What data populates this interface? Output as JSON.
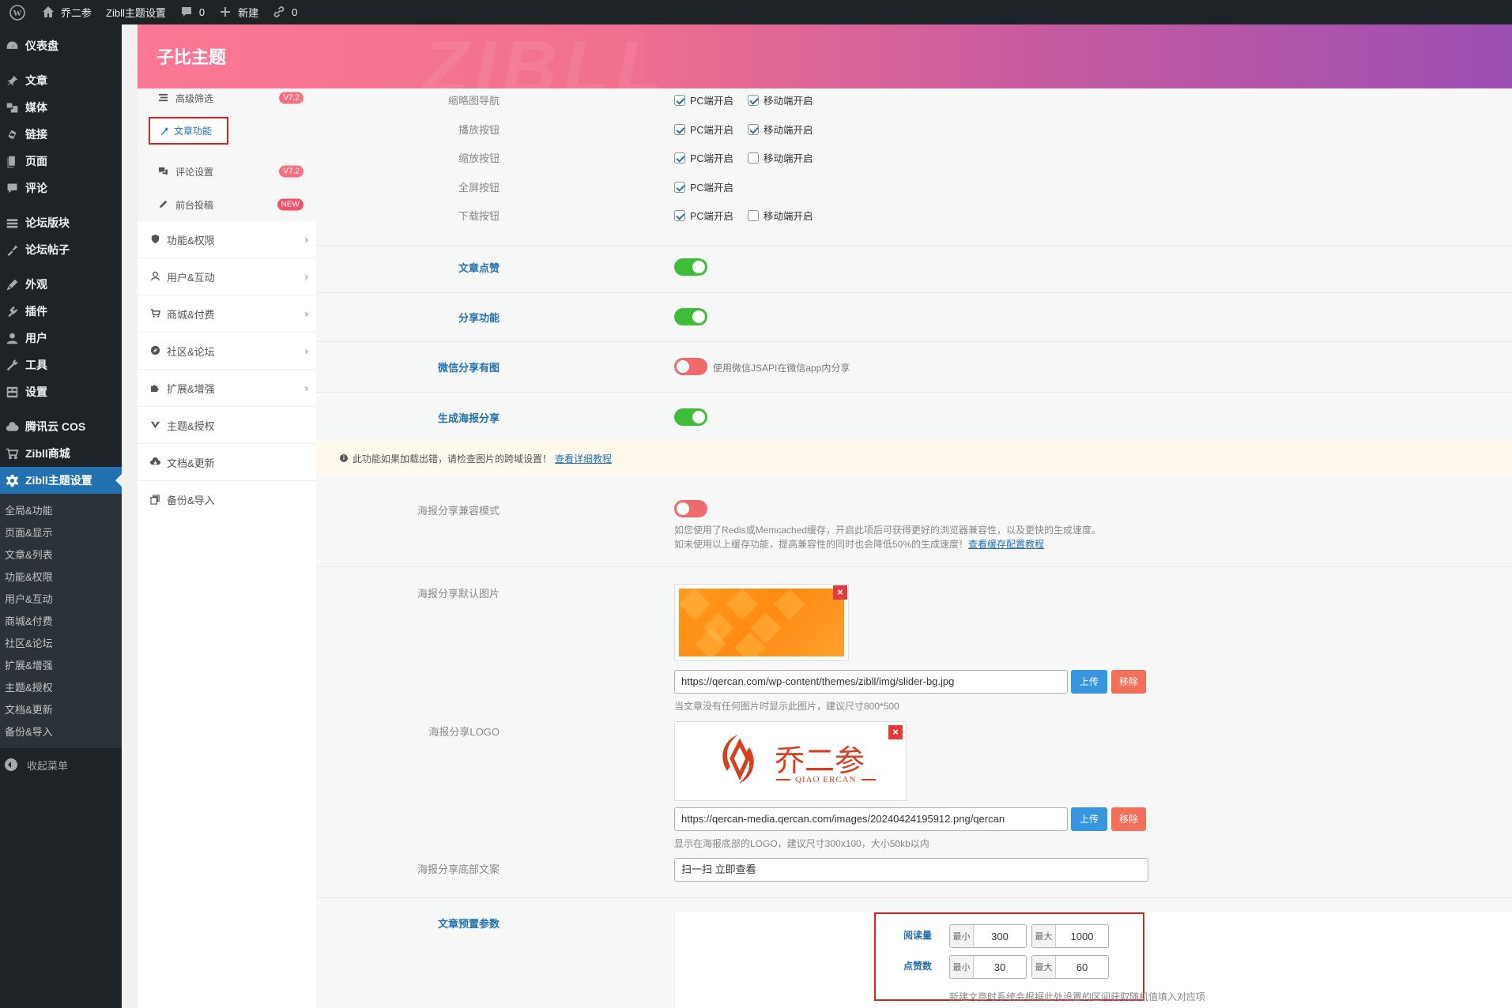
{
  "adminbar": {
    "site_name": "乔二参",
    "theme_settings": "Zibll主题设置",
    "comments_count": "0",
    "new_label": "新建",
    "links_count": "0"
  },
  "adminmenu": {
    "items": [
      {
        "label": "仪表盘",
        "icon": "dashboard-icon"
      },
      {
        "label": "文章",
        "icon": "pin-icon"
      },
      {
        "label": "媒体",
        "icon": "media-icon"
      },
      {
        "label": "链接",
        "icon": "link-icon"
      },
      {
        "label": "页面",
        "icon": "page-icon"
      },
      {
        "label": "评论",
        "icon": "comment-icon"
      },
      {
        "label": "论坛版块",
        "icon": "forum-section-icon"
      },
      {
        "label": "论坛帖子",
        "icon": "forum-post-icon"
      },
      {
        "label": "外观",
        "icon": "appearance-icon"
      },
      {
        "label": "插件",
        "icon": "plugin-icon"
      },
      {
        "label": "用户",
        "icon": "user-icon"
      },
      {
        "label": "工具",
        "icon": "tools-icon"
      },
      {
        "label": "设置",
        "icon": "settings-icon"
      },
      {
        "label": "腾讯云 COS",
        "icon": "cloud-icon"
      },
      {
        "label": "Zibll商城",
        "icon": "cart-icon"
      },
      {
        "label": "Zibll主题设置",
        "icon": "gear-icon"
      }
    ],
    "submenu": [
      "全局&功能",
      "页面&显示",
      "文章&列表",
      "功能&权限",
      "用户&互动",
      "商城&付费",
      "社区&论坛",
      "扩展&增强",
      "主题&授权",
      "文档&更新",
      "备份&导入"
    ],
    "collapse_label": "收起菜单"
  },
  "header": {
    "title": "子比主题",
    "watermark": "ZIBLL"
  },
  "theme_nav": {
    "subitems": [
      {
        "label": "高级筛选",
        "badge": "V7.2"
      },
      {
        "label": "文章功能",
        "badge": ""
      },
      {
        "label": "评论设置",
        "badge": "V7.2"
      },
      {
        "label": "前台投稿",
        "badge": "NEW"
      }
    ],
    "groups": [
      "功能&权限",
      "用户&互动",
      "商城&付费",
      "社区&论坛",
      "扩展&增强",
      "主题&授权",
      "文档&更新",
      "备份&导入"
    ]
  },
  "content": {
    "checkbox_rows": [
      {
        "label": "缩略图导航",
        "pc": "PC端开启",
        "pc_on": true,
        "mobile": "移动端开启",
        "mobile_on": true
      },
      {
        "label": "播放按钮",
        "pc": "PC端开启",
        "pc_on": true,
        "mobile": "移动端开启",
        "mobile_on": true
      },
      {
        "label": "缩放按钮",
        "pc": "PC端开启",
        "pc_on": true,
        "mobile": "移动端开启",
        "mobile_on": false
      },
      {
        "label": "全屏按钮",
        "pc": "PC端开启",
        "pc_on": true,
        "mobile": "",
        "mobile_on": false
      },
      {
        "label": "下载按钮",
        "pc": "PC端开启",
        "pc_on": true,
        "mobile": "移动端开启",
        "mobile_on": false
      }
    ],
    "toggles": [
      {
        "label": "文章点赞",
        "on": true,
        "desc": ""
      },
      {
        "label": "分享功能",
        "on": true,
        "desc": ""
      },
      {
        "label": "微信分享有图",
        "on": false,
        "desc": "使用微信JSAPI在微信app内分享"
      },
      {
        "label": "生成海报分享",
        "on": true,
        "desc": ""
      }
    ],
    "notice": {
      "text": "此功能如果加载出错，请检查图片的跨域设置！",
      "link": "查看详细教程"
    },
    "compat": {
      "label": "海报分享兼容模式",
      "on": false,
      "desc1": "如您使用了Redis或Memcached缓存，开启此项后可获得更好的浏览器兼容性，以及更快的生成速度。",
      "desc2": "如未使用以上缓存功能，提高兼容性的同时也会降低50%的生成速度！",
      "desc2_link": "查看缓存配置教程"
    },
    "default_image": {
      "label": "海报分享默认图片",
      "url": "https://qercan.com/wp-content/themes/zibll/img/slider-bg.jpg",
      "upload": "上传",
      "remove": "移除",
      "hint": "当文章没有任何图片时显示此图片，建议尺寸800*500"
    },
    "logo": {
      "label": "海报分享LOGO",
      "logo_text": "乔二参",
      "logo_sub": "QIAO ERCAN",
      "url": "https://qercan-media.qercan.com/images/20240424195912.png/qercan",
      "upload": "上传",
      "remove": "移除",
      "hint": "显示在海报底部的LOGO，建议尺寸300x100，大小50kb以内"
    },
    "footer_text": {
      "label": "海报分享底部文案",
      "value": "扫一扫 立即查看"
    },
    "preset": {
      "label": "文章预置参数",
      "views_label": "阅读量",
      "likes_label": "点赞数",
      "min": "最小",
      "max": "最大",
      "views_min": "300",
      "views_max": "1000",
      "likes_min": "30",
      "likes_max": "60",
      "hint": "新建文章时系统会根据此处设置的区间获取随机值填入对应项"
    }
  },
  "colors": {
    "accent": "#2271b1",
    "toggle_on": "#3ebc3a",
    "toggle_off": "#f06a6a",
    "header_start": "#fb7895",
    "header_end": "#9b4fb2"
  }
}
